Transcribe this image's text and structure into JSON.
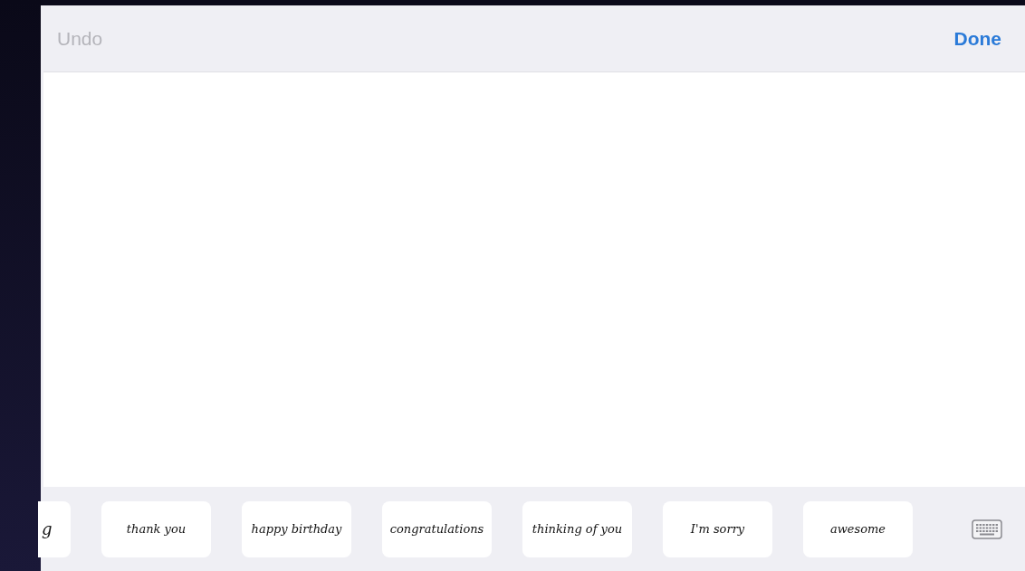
{
  "toolbar": {
    "undo": {
      "label": "Undo",
      "disabled": true
    },
    "done": {
      "label": "Done"
    }
  },
  "suggestions": [
    {
      "text": "g",
      "partial": true
    },
    {
      "text": "thank you",
      "partial": false
    },
    {
      "text": "happy birthday",
      "partial": false
    },
    {
      "text": "congratulations",
      "partial": false
    },
    {
      "text": "thinking of you",
      "partial": false
    },
    {
      "text": "I'm sorry",
      "partial": false
    },
    {
      "text": "awesome",
      "partial": false
    }
  ]
}
